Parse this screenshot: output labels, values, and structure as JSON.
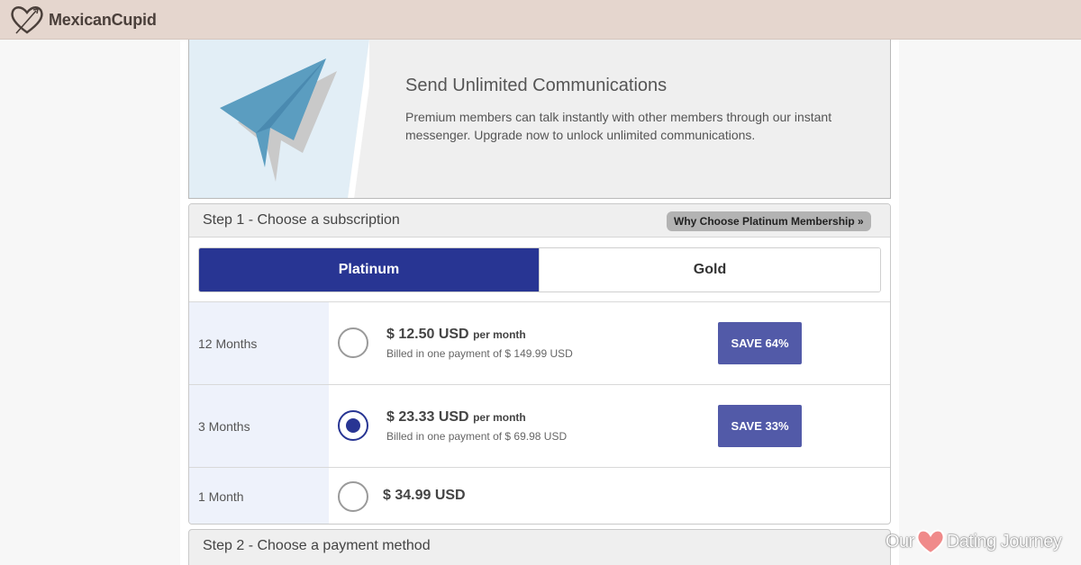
{
  "header": {
    "brand": "MexicanCupid"
  },
  "hero": {
    "title": "Send Unlimited Communications",
    "description": "Premium members can talk instantly with other members through our instant messenger. Upgrade now to unlock unlimited communications."
  },
  "step1": {
    "title": "Step 1 - Choose a subscription",
    "why_button": "Why Choose Platinum Membership »",
    "tabs": [
      {
        "label": "Platinum",
        "active": true
      },
      {
        "label": "Gold",
        "active": false
      }
    ],
    "plans": [
      {
        "duration": "12 Months",
        "price": "$ 12.50 USD",
        "per": "per month",
        "billed": "Billed in one payment of $ 149.99 USD",
        "save": "SAVE 64%",
        "selected": false
      },
      {
        "duration": "3 Months",
        "price": "$ 23.33 USD",
        "per": "per month",
        "billed": "Billed in one payment of $ 69.98 USD",
        "save": "SAVE 33%",
        "selected": true
      },
      {
        "duration": "1 Month",
        "price": "$ 34.99 USD",
        "selected": false
      }
    ]
  },
  "step2": {
    "title": "Step 2 - Choose a payment method"
  },
  "watermark": {
    "left": "Our",
    "right": "Dating Journey"
  },
  "colors": {
    "header_bg": "#e5d6ce",
    "platinum": "#283593",
    "save_bg": "#525aa8",
    "plane": "#5b9dc0",
    "heart": "#f08a8a"
  }
}
